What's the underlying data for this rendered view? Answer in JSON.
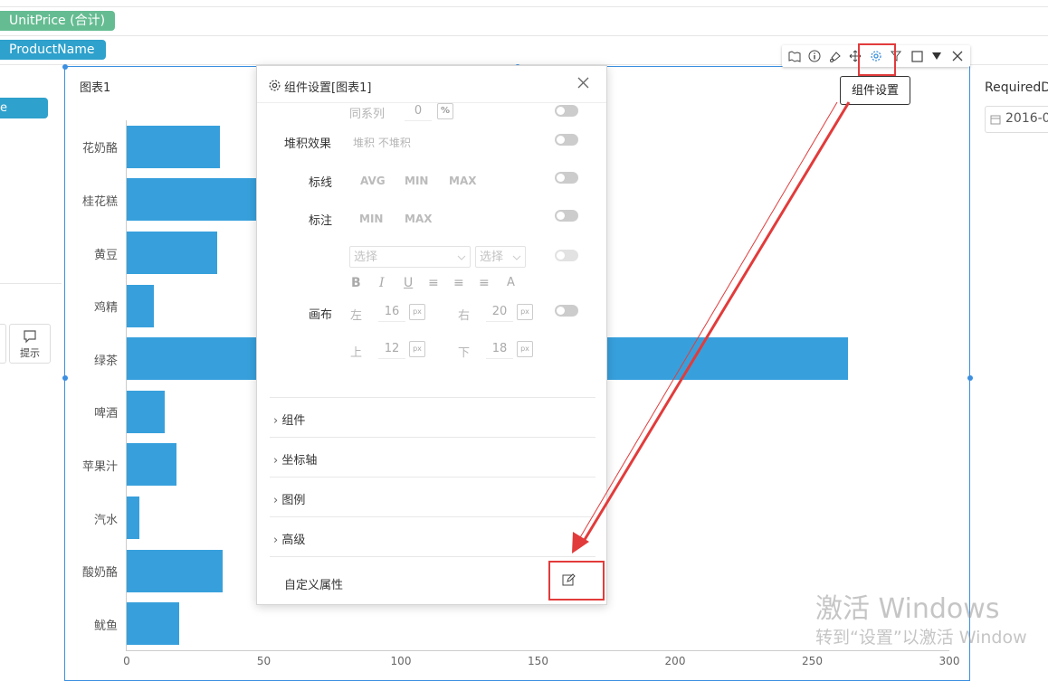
{
  "fields": {
    "unit_price": "UnitPrice (合计)",
    "product_name": "ProductName",
    "left_pill": "e",
    "colors": {
      "unit_price": "#65bc92",
      "product_name": "#2ea1cc"
    }
  },
  "left_panel": {
    "tip_label": "提示"
  },
  "chart": {
    "title": "图表1",
    "bar_color": "#37a0dc"
  },
  "chart_data": {
    "type": "bar",
    "orientation": "horizontal",
    "title": "图表1",
    "categories": [
      "花奶酪",
      "桂花糕",
      "黄豆",
      "鸡精",
      "绿茶",
      "啤酒",
      "苹果汁",
      "汽水",
      "酸奶酪",
      "鱿鱼"
    ],
    "values": [
      34,
      81,
      33,
      10,
      263,
      14,
      18,
      4.5,
      35,
      19
    ],
    "xlim": [
      0,
      300
    ],
    "xticks": [
      "0",
      "50",
      "100",
      "150",
      "200",
      "250",
      "300"
    ]
  },
  "toolbar": {
    "icons": [
      "map-icon",
      "info-icon",
      "paint-icon",
      "move-icon",
      "gear-icon",
      "filter-icon",
      "square-icon",
      "dropdown-icon",
      "close-icon"
    ],
    "tooltip": "组件设置"
  },
  "right_panel": {
    "required_date_label": "RequiredDa",
    "date_value": "2016-0"
  },
  "settings_panel": {
    "title": "组件设置[图表1]",
    "same_series_label": "同系列",
    "same_series_value": "0",
    "same_series_unit": "%",
    "stack_label": "堆积效果",
    "stack_options": "堆积  不堆积",
    "markline_label": "标线",
    "markline_options": [
      "AVG",
      "MIN",
      "MAX"
    ],
    "markpoint_label": "标注",
    "markpoint_options": [
      "MIN",
      "MAX"
    ],
    "select_placeholder_1": "选择",
    "select_placeholder_2": "选择",
    "format_buttons": [
      "B",
      "I",
      "U",
      "≡",
      "≡",
      "≡",
      "A"
    ],
    "canvas_label": "画布",
    "canvas": {
      "left_label": "左",
      "left_value": "16",
      "right_label": "右",
      "right_value": "20",
      "top_label": "上",
      "top_value": "12",
      "bottom_label": "下",
      "bottom_value": "18",
      "unit": "px"
    },
    "sections": [
      "组件",
      "坐标轴",
      "图例",
      "高级"
    ],
    "custom_props_label": "自定义属性"
  },
  "watermark": {
    "line1": "激活 Windows",
    "line2": "转到“设置”以激活 Window"
  },
  "annotation_color": "#e23b3b"
}
